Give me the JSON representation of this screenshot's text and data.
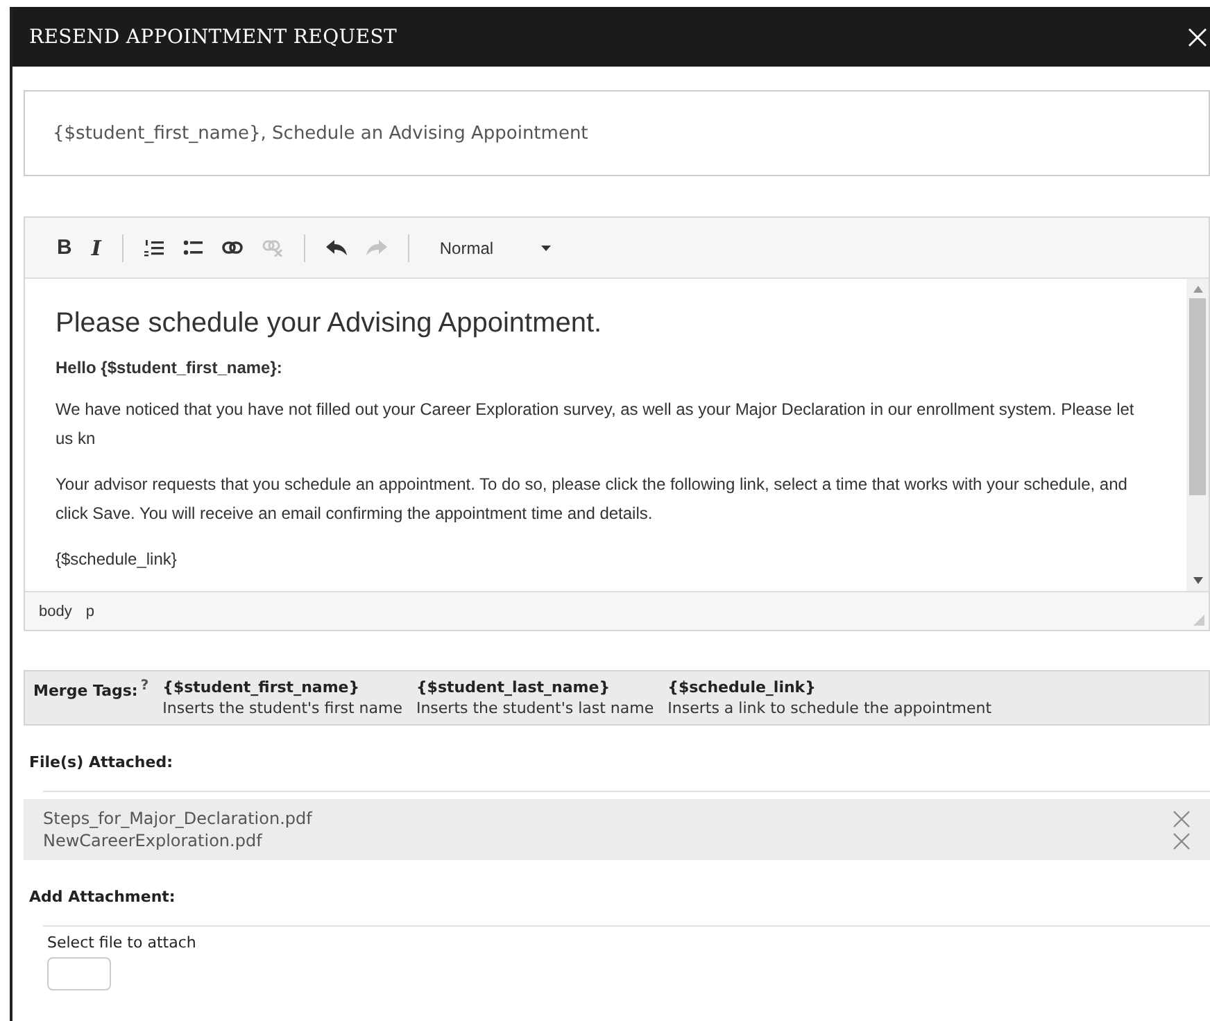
{
  "dialog": {
    "title": "RESEND APPOINTMENT REQUEST"
  },
  "subject": {
    "value": "{$student_first_name}, Schedule an Advising Appointment"
  },
  "toolbar": {
    "groups": [
      [
        {
          "kind": "bold",
          "label": "B",
          "disabled": false
        },
        {
          "kind": "italic",
          "label": "I",
          "disabled": false
        }
      ],
      [
        {
          "kind": "numbered-list",
          "disabled": false
        },
        {
          "kind": "bulleted-list",
          "disabled": false
        },
        {
          "kind": "link",
          "disabled": false
        },
        {
          "kind": "unlink",
          "disabled": true
        }
      ],
      [
        {
          "kind": "undo",
          "disabled": false
        },
        {
          "kind": "redo",
          "disabled": true
        }
      ]
    ],
    "format": "Normal"
  },
  "content": {
    "heading": "Please schedule your Advising Appointment.",
    "greeting": "Hello {$student_first_name}:",
    "paragraphs": [
      "We have noticed that you have not filled out your Career Exploration survey, as well as your Major Declaration in our enrollment system. Please let us kn",
      "Your advisor requests that you schedule an appointment. To do so, please click the following link, select a time that works with your schedule, and click Save. You will receive an email confirming the appointment time and details."
    ],
    "link_tag": "{$schedule_link}"
  },
  "status_path": [
    "body",
    "p"
  ],
  "merge_tags": {
    "label": "Merge Tags:",
    "help": "?",
    "tags": [
      {
        "tag": "{$student_first_name}",
        "description": "Inserts the student's first name"
      },
      {
        "tag": "{$student_last_name}",
        "description": "Inserts the student's last name"
      },
      {
        "tag": "{$schedule_link}",
        "description": "Inserts a link to schedule the appointment"
      }
    ]
  },
  "attachments": {
    "label": "File(s) Attached:",
    "files": [
      "Steps_for_Major_Declaration.pdf",
      "NewCareerExploration.pdf"
    ]
  },
  "add_attachment": {
    "label": "Add Attachment:",
    "hint": "Select file to attach"
  }
}
